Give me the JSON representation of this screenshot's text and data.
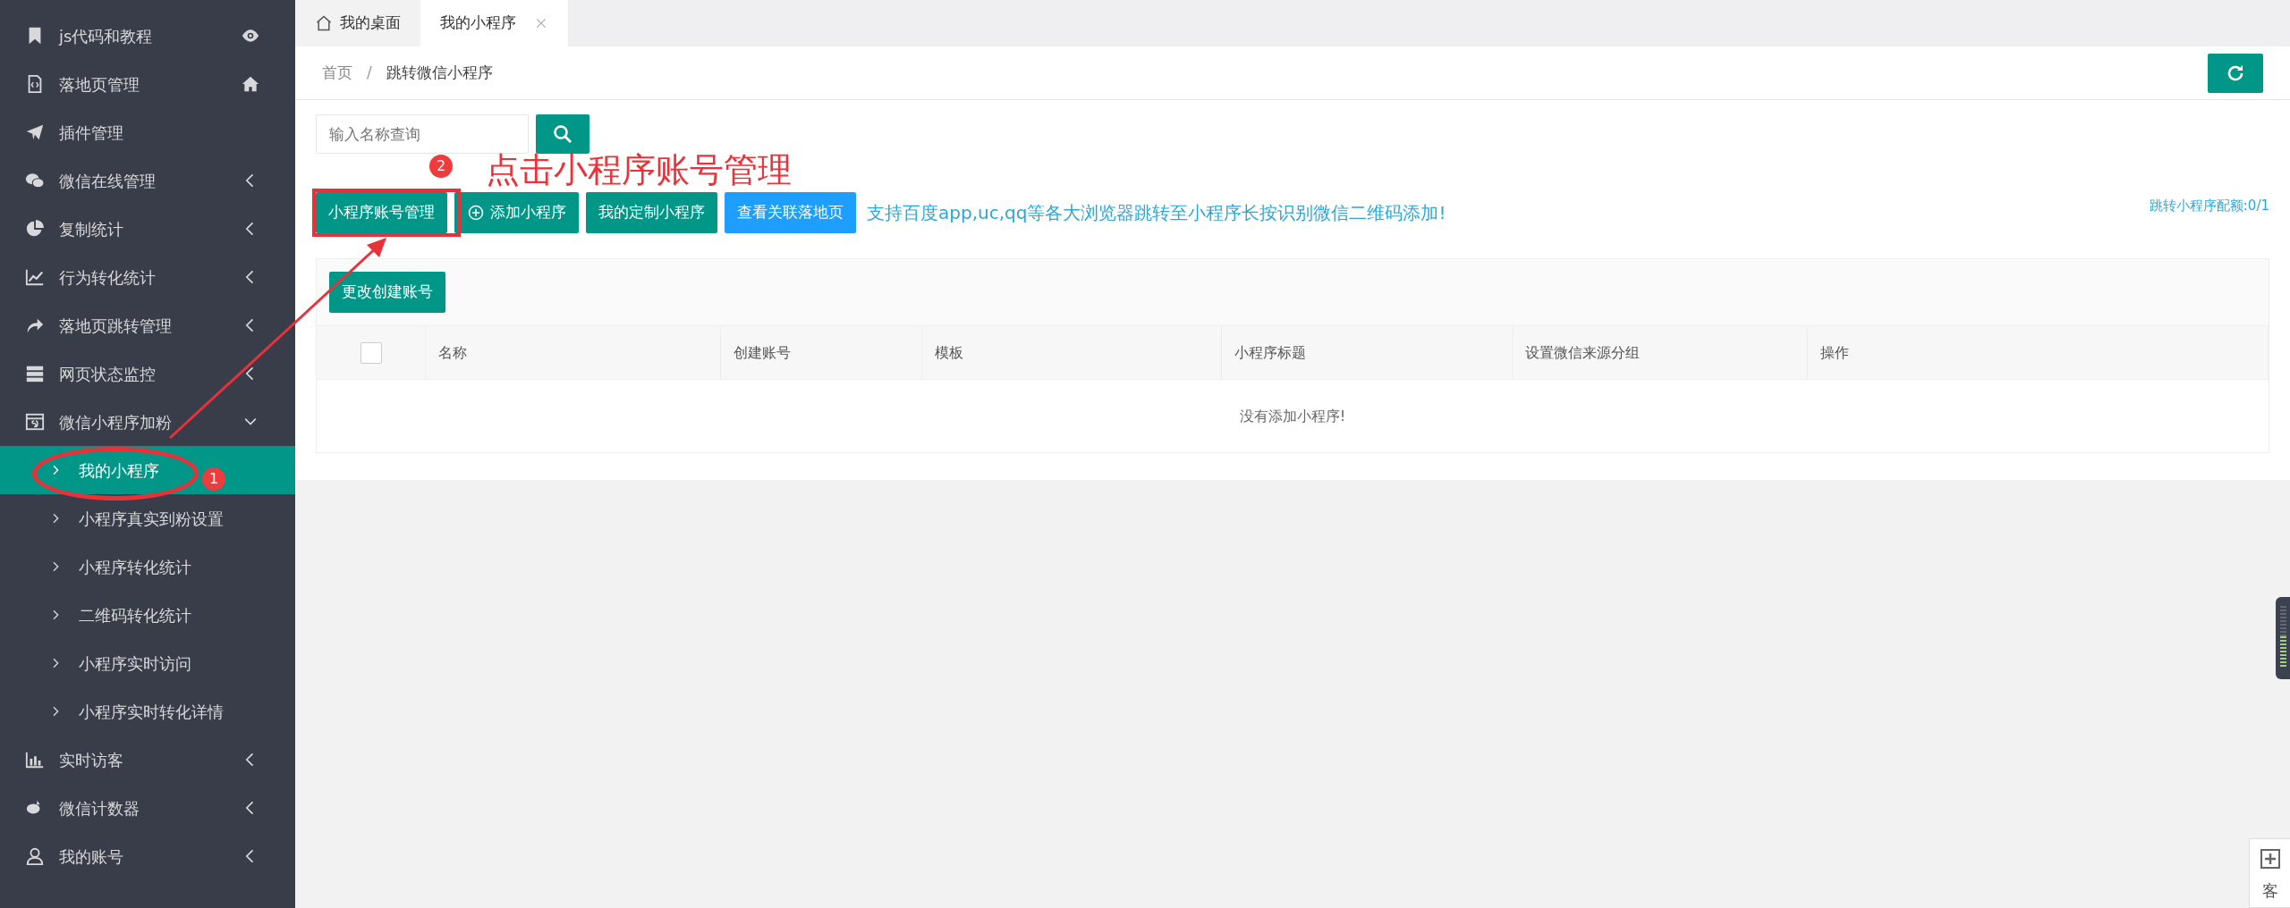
{
  "sidebar": {
    "items": [
      {
        "label": "js代码和教程",
        "selected": false
      },
      {
        "label": "落地页管理",
        "selected": false
      },
      {
        "label": "插件管理",
        "selected": false
      },
      {
        "label": "微信在线管理",
        "selected": false,
        "expanded": false
      },
      {
        "label": "复制统计",
        "selected": false,
        "expanded": false
      },
      {
        "label": "行为转化统计",
        "selected": false,
        "expanded": false
      },
      {
        "label": "落地页跳转管理",
        "selected": false,
        "expanded": false
      },
      {
        "label": "网页状态监控",
        "selected": false,
        "expanded": false
      },
      {
        "label": "微信小程序加粉",
        "selected": false,
        "expanded": true,
        "children": [
          {
            "label": "我的小程序",
            "selected": true
          },
          {
            "label": "小程序真实到粉设置",
            "selected": false
          },
          {
            "label": "小程序转化统计",
            "selected": false
          },
          {
            "label": "二维码转化统计",
            "selected": false
          },
          {
            "label": "小程序实时访问",
            "selected": false
          },
          {
            "label": "小程序实时转化详情",
            "selected": false
          }
        ]
      },
      {
        "label": "实时访客",
        "selected": false,
        "expanded": false
      },
      {
        "label": "微信计数器",
        "selected": false,
        "expanded": false
      },
      {
        "label": "我的账号",
        "selected": false,
        "expanded": false
      }
    ]
  },
  "tabs": [
    {
      "label": "我的桌面",
      "selected": false,
      "closable": false
    },
    {
      "label": "我的小程序",
      "selected": true,
      "closable": true
    }
  ],
  "breadcrumb": [
    "首页",
    "跳转微信小程序"
  ],
  "breadcrumb_separator": "/",
  "search": {
    "placeholder": "输入名称查询"
  },
  "toolbar": {
    "buttons": [
      {
        "label": "小程序账号管理",
        "kind": "plain",
        "color": "#009688"
      },
      {
        "label": "添加小程序",
        "kind": "add",
        "color": "#009688"
      },
      {
        "label": "我的定制小程序",
        "kind": "plain",
        "color": "#009688"
      },
      {
        "label": "查看关联落地页",
        "kind": "plain",
        "color": "#1e9fff"
      }
    ],
    "notice": "支持百度app,uc,qq等各大浏览器跳转至小程序长按识别微信二维码添加!",
    "quota": "跳转小程序配额:0/1"
  },
  "table": {
    "toolbar_button": "更改创建账号",
    "select_all_checked": false,
    "columns": [
      "名称",
      "创建账号",
      "模板",
      "小程序标题",
      "设置微信来源分组",
      "操作"
    ],
    "empty_text": "没有添加小程序!"
  },
  "annotations": {
    "instruction": "点击小程序账号管理",
    "step_1": "1",
    "step_2": "2"
  },
  "floating": {
    "service_label": "客"
  }
}
